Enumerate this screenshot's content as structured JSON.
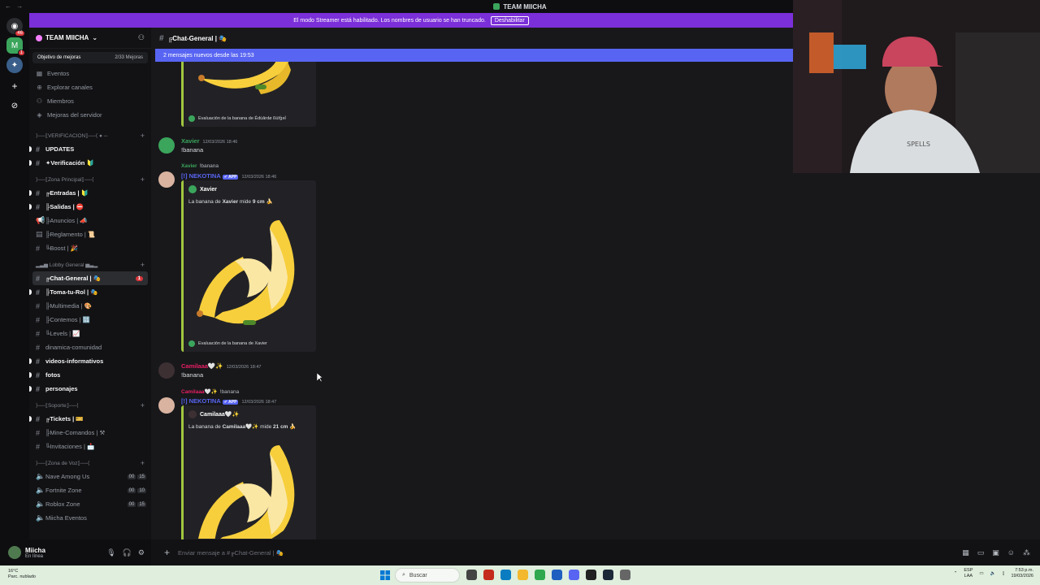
{
  "window": {
    "title": "TEAM MIICHA"
  },
  "rail": {
    "dm_badge": "46",
    "server_badge": "1"
  },
  "banner": {
    "text": "El modo Streamer está habilitado. Los nombres de usuario se han truncado.",
    "button": "Deshabilitar"
  },
  "server": {
    "name": "TEAM MIICHA",
    "boost_label": "Objetivo de mejoras",
    "boost_progress": "2/33 Mejoras",
    "items": [
      {
        "icon": "calendar-icon",
        "label": "Eventos"
      },
      {
        "icon": "compass-icon",
        "label": "Explorar canales"
      },
      {
        "icon": "members-icon",
        "label": "Miembros"
      },
      {
        "icon": "boost-icon",
        "label": "Mejoras del servidor"
      }
    ]
  },
  "categories": {
    "verificacion": "⟩──⟦VERIFICACION⟧──⟨ ● ─",
    "principal": "⟩──⟦Zona Principal⟧──⟨",
    "lobby": "▂▃▅ Lobby General ▅▃▂",
    "soporte": "⟩──⟦Soporte⟧──⟨",
    "voz": "⟩──⟦Zona de Voz⟧──⟨"
  },
  "channels": {
    "updates": "UPDATES",
    "verificacion": "✦Verificación 🔰",
    "entradas": "╔Entradas | 🔰",
    "salidas": "╠Salidas | ⛔",
    "anuncios": "╠Anuncios | 📣",
    "reglamento": "╠Reglamento | 📜",
    "boost": "╚Boost | 🎉",
    "chat_general": "╔Chat-General | 🎭",
    "chat_general_badge": "1",
    "toma_rol": "╠Toma-tu-Rol | 🎭",
    "multimedia": "╠Multimedia | 🎨",
    "contemos": "╠Contemos | 🔢",
    "levels": "╚Levels | 📈",
    "dinamica": "dinamica-comunidad",
    "videos": "videos-informativos",
    "fotos": "fotos",
    "personajes": "personajes",
    "tickets": "╔Tickets | 🎫",
    "mine": "╠Mine-Comandos | ⚒",
    "invitaciones": "╚Invitaciones | 📩",
    "among": "Nave Among Us",
    "among_cnt": [
      "00",
      "15"
    ],
    "fortnite": "Fortnite Zone",
    "fortnite_cnt": [
      "00",
      "10"
    ],
    "roblox": "Roblox Zone",
    "roblox_cnt": [
      "00",
      "15"
    ],
    "eventos": "Miicha Eventos"
  },
  "user": {
    "name": "Miicha",
    "status": "En línea"
  },
  "chat": {
    "channel": "╔Chat-General | 🎭",
    "new_messages": "2 mensajes nuevos desde las 19:53",
    "composer_placeholder": "Enviar mensaje a #╔Chat-General | 🎭",
    "top_embed_footer": "Evaluación de la banana de Édùărdø ßùřģəİ",
    "messages": [
      {
        "author": "Xavier",
        "time": "12/03/2026 18:46",
        "text": "!banana"
      },
      {
        "reply_author": "Xavier",
        "reply_text": "!banana",
        "author": "[!] NEKOTINA",
        "app_tag": "✔ APP",
        "time": "12/03/2026 18:46",
        "embed_author": "Xavier",
        "embed_desc_pre": "La banana de",
        "embed_desc_name": "Xavier",
        "embed_desc_mid": "mide",
        "embed_desc_val": "9 cm 🍌",
        "embed_footer": "Evaluación de la banana de Xavier"
      },
      {
        "author": "Camilaaa🤍✨",
        "time": "12/03/2026 18:47",
        "text": "!banana"
      },
      {
        "reply_author": "Camilaaa🤍✨",
        "reply_text": "!banana",
        "author": "[!] NEKOTINA",
        "app_tag": "✔ APP",
        "time": "12/03/2026 18:47",
        "embed_author": "Camilaaa🤍✨",
        "embed_desc_pre": "La banana de",
        "embed_desc_name": "Camilaaa🤍✨",
        "embed_desc_mid": "mide",
        "embed_desc_val": "21 cm 🍌"
      }
    ]
  },
  "taskbar": {
    "weather_temp": "16°C",
    "weather_desc": "Parc. nublado",
    "search": "Buscar",
    "lang1": "ESP",
    "lang2": "LAA",
    "time": "7:53 p.m.",
    "date": "19/03/2026"
  },
  "colors": {
    "blurple": "#5865f2",
    "streamer_banner": "#7b2fd8",
    "xavier": "#3ba55c",
    "camila": "#e91e63",
    "embed_bar": "#a0c540"
  }
}
